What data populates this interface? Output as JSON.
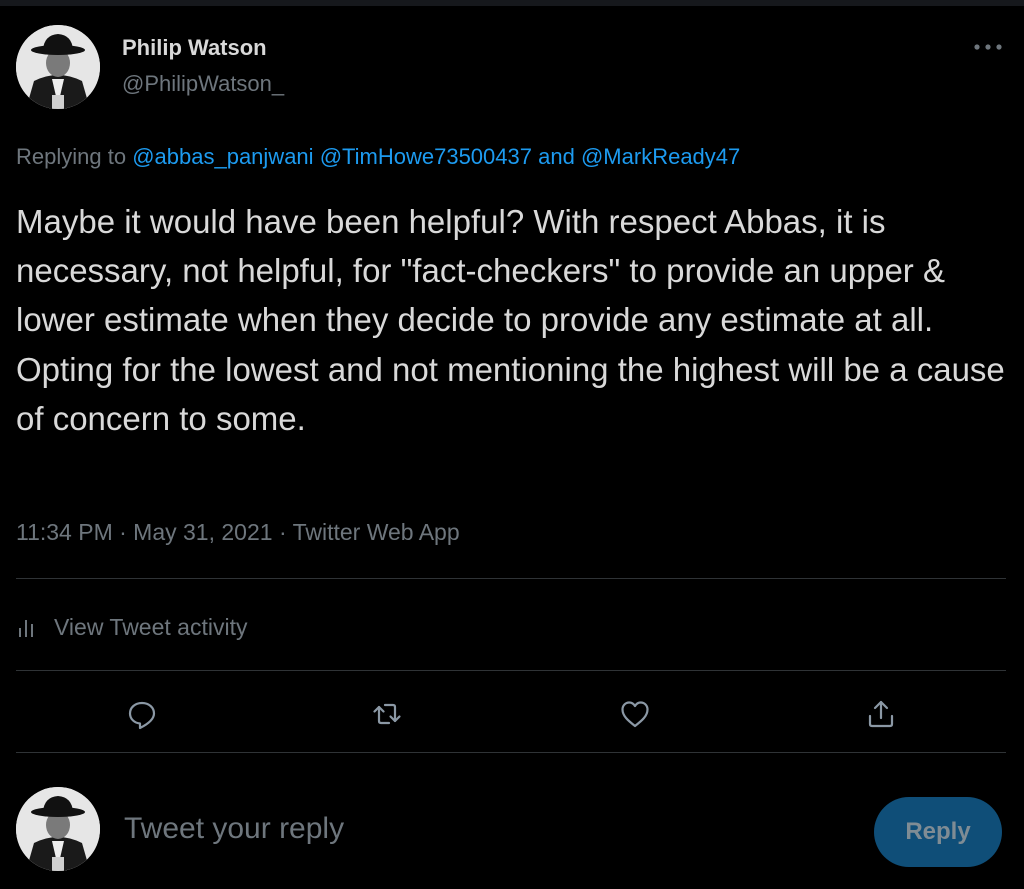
{
  "tweet": {
    "author_name": "Philip Watson",
    "author_handle": "@PhilipWatson_",
    "more_icon": "more-horizontal-icon",
    "replying": {
      "prefix": "Replying to",
      "mentions": [
        "@abbas_panjwani",
        "@TimHowe73500437",
        "@MarkReady47"
      ],
      "joiner": "and"
    },
    "text": "Maybe it would have been helpful? With respect Abbas, it is necessary, not helpful, for \"fact-checkers\" to provide an upper & lower estimate when they decide to provide any estimate at all. Opting for the lowest and not mentioning the highest will be a cause of concern to some.",
    "meta": "11:34 PM · May 31, 2021 · Twitter Web App",
    "activity_label": "View Tweet activity"
  },
  "actions": {
    "icons": [
      "reply-icon",
      "retweet-icon",
      "like-icon",
      "share-icon"
    ]
  },
  "composer": {
    "placeholder": "Tweet your reply",
    "button_label": "Reply"
  },
  "colors": {
    "background": "#000000",
    "text": "#d9d9d9",
    "muted": "#6e767d",
    "accent": "#1d9bf0",
    "reply_button": "#0f4e78",
    "divider": "#2f3336"
  }
}
